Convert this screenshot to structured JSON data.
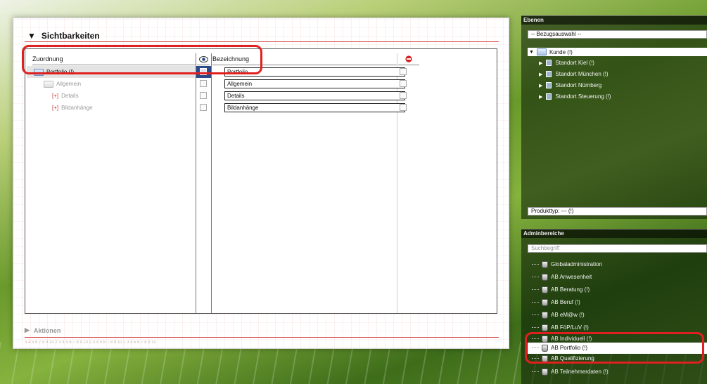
{
  "section": {
    "title": "Sichtbarkeiten",
    "collapse_icon": "triangle-down-icon"
  },
  "grid": {
    "headers": {
      "zuordnung": "Zuordnung",
      "visibility_icon": "eye-icon",
      "bezeichnung": "Bezeichnung",
      "delete_icon": "no-entry-icon"
    },
    "rows": [
      {
        "label": "Portfolio (!)",
        "value": "Portfolio",
        "prefix": ""
      },
      {
        "label": "Allgemein",
        "value": "Allgemein",
        "prefix": ""
      },
      {
        "label": "Details",
        "value": "Details",
        "prefix": "[+]"
      },
      {
        "label": "Bildanhänge",
        "value": "Bildanhänge",
        "prefix": "[+]"
      }
    ]
  },
  "aktionen": {
    "label": "Aktionen"
  },
  "ruler": "3 4 5 6 7 8 9 10   2 3 4 5 6 7 8 9 10   2 3 4 5 6 7 8 9 10   2 3 4 5 6 7 8 9 10",
  "ebenen": {
    "title": "Ebenen",
    "select": "-- Bezugsauswahl --",
    "root": "Kunde (!)",
    "children": [
      "Standort Kiel (!)",
      "Standort München (!)",
      "Standort Nürnberg",
      "Standort Steuerung (!)"
    ],
    "produkttyp": "Produkttyp: --- (!)"
  },
  "adminbereiche": {
    "title": "Adminbereiche",
    "search_placeholder": "Suchbegriff",
    "items": [
      "Globaladministration",
      "AB Anwesenheit",
      "AB Beratung (!)",
      "AB Beruf (!)",
      "AB eM@w (!)",
      "AB FöP/LuV (!)",
      "AB Individuell (!)",
      "AB Portfolio (!)",
      "AB Qualifizierung",
      "AB Teilnehmerdaten (!)"
    ]
  },
  "colors": {
    "annotation": "#e02020",
    "accent_red": "#d24040"
  }
}
